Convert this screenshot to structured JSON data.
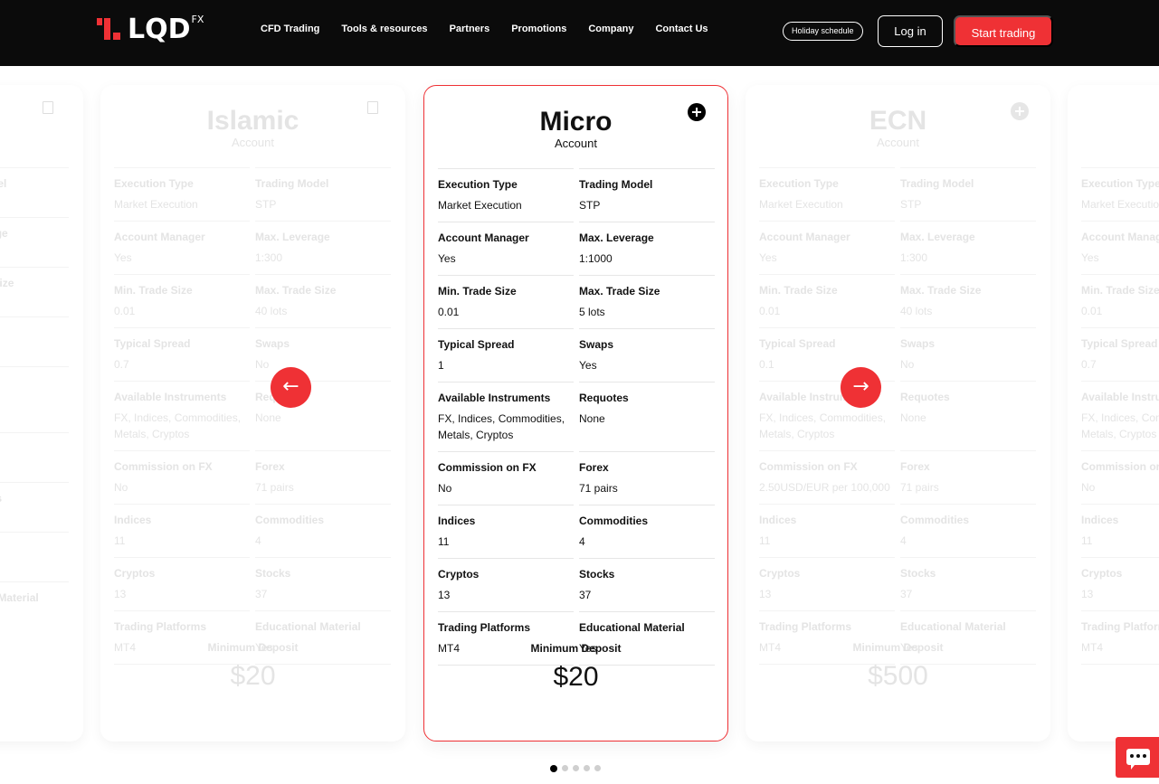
{
  "header": {
    "logo_text": "LQD",
    "logo_superscript": "FX",
    "nav": [
      "CFD Trading",
      "Tools & resources",
      "Partners",
      "Promotions",
      "Company",
      "Contact Us"
    ],
    "holiday_label": "Holiday schedule",
    "login_label": "Log in",
    "start_label": "Start trading"
  },
  "colors": {
    "accent": "#ef3135",
    "header_bg": "#0b0b0b"
  },
  "fields": [
    "Execution Type",
    "Trading Model",
    "Account Manager",
    "Max. Leverage",
    "Min. Trade Size",
    "Max. Trade Size",
    "Typical Spread",
    "Swaps",
    "Available Instruments",
    "Requotes",
    "Commission on FX",
    "Forex",
    "Indices",
    "Commodities",
    "Cryptos",
    "Stocks",
    "Trading Platforms",
    "Educational Material"
  ],
  "deposit_label": "Minimum Deposit",
  "account_subtitle": "Account",
  "cards": {
    "left_partial": {
      "labels_visible": [
        "el",
        "ge",
        "ize",
        "",
        "",
        "",
        "s",
        "",
        "Material"
      ]
    },
    "islamic": {
      "title": "Islamic",
      "values": [
        "Market Execution",
        "STP",
        "Yes",
        "1:300",
        "0.01",
        "40 lots",
        "0.7",
        "No",
        "FX, Indices, Commodities, Metals, Cryptos",
        "None",
        "No",
        "71 pairs",
        "11",
        "4",
        "13",
        "37",
        "MT4",
        "Yes"
      ],
      "deposit": "$20"
    },
    "micro": {
      "title": "Micro",
      "values": [
        "Market Execution",
        "STP",
        "Yes",
        "1:1000",
        "0.01",
        "5 lots",
        "1",
        "Yes",
        "FX, Indices, Commodities, Metals, Cryptos",
        "None",
        "No",
        "71 pairs",
        "11",
        "4",
        "13",
        "37",
        "MT4",
        "Yes"
      ],
      "deposit": "$20"
    },
    "ecn": {
      "title": "ECN",
      "values": [
        "Market Execution",
        "STP",
        "Yes",
        "1:300",
        "0.01",
        "40 lots",
        "0.1",
        "No",
        "FX, Indices, Commodities, Metals, Cryptos",
        "None",
        "2.50USD/EUR per 100,000",
        "71 pairs",
        "11",
        "4",
        "13",
        "37",
        "MT4",
        "Yes"
      ],
      "deposit": "$500"
    },
    "right_partial": {
      "values": [
        "Market Execution",
        "Yes",
        "0.01",
        "0.7",
        "FX, Indices, Commodities, Metals, Cryptos",
        "No",
        "11",
        "13",
        "MT4"
      ]
    }
  },
  "carousel": {
    "prev_icon": "arrow-left-icon",
    "next_icon": "arrow-right-icon",
    "total_pages": 5,
    "current_page": 1
  },
  "chat": {
    "icon": "chat-icon"
  }
}
